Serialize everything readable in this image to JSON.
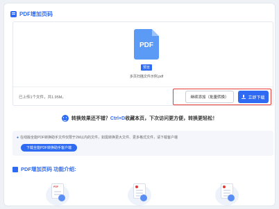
{
  "header": {
    "title": "PDF增加页码"
  },
  "upload": {
    "file_icon_text": "PDF",
    "file_badge": "预览",
    "file_name": "多页扫描文件示例.pdf",
    "summary": "已上传1个文件，共1.95M。",
    "add_button": "继续添加（批量转换）",
    "download_button": "立即下载"
  },
  "tip": {
    "prefix": "转换效果还不错？",
    "key": "Ctrl+D",
    "suffix": "收藏本页，下次访问更方便，转换更轻松！"
  },
  "notice": {
    "text": "在线版全能PDF转换助手文件仅限于2M以内的文件，如需转换更大文件、更多格式文件，请下载客户端",
    "client_button": "下载全能PDF转换助手客户端"
  },
  "intro": {
    "title": "PDF增加页码 功能介绍:"
  },
  "features": [
    {
      "icon": "pdf-upload-icon",
      "label": "PDF"
    },
    {
      "icon": "doc-settings-icon"
    },
    {
      "icon": "doc-result-icon"
    }
  ],
  "colors": {
    "accent": "#2f6bf2",
    "highlight": "#e53935"
  }
}
